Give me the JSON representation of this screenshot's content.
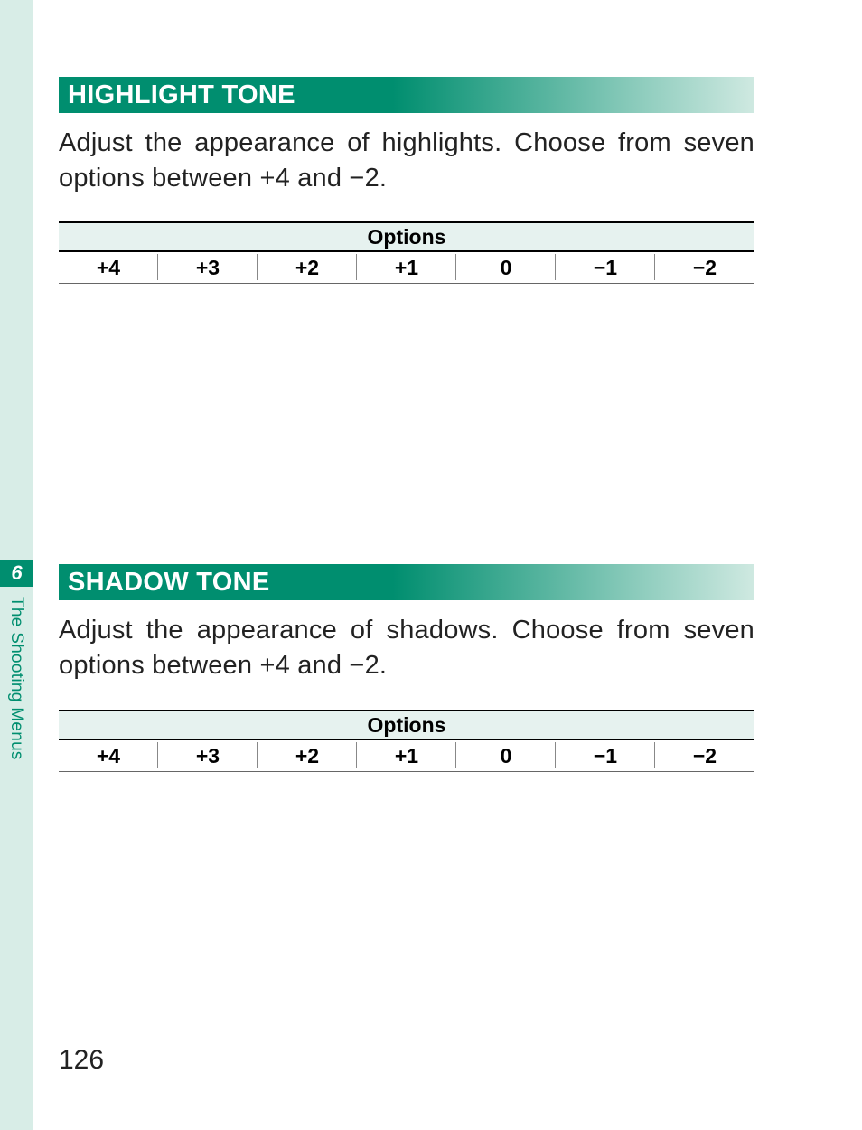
{
  "sidebar": {
    "chapter_number": "6",
    "chapter_title": "The Shooting Menus"
  },
  "sections": [
    {
      "heading": "HIGHLIGHT TONE",
      "body": "Adjust the appearance of highlights. Choose from seven options between +4 and −2.",
      "options_header": "Options",
      "options": [
        "+4",
        "+3",
        "+2",
        "+1",
        "0",
        "−1",
        "−2"
      ]
    },
    {
      "heading": "SHADOW TONE",
      "body": "Adjust the appearance of shadows. Choose from seven options between +4 and −2.",
      "options_header": "Options",
      "options": [
        "+4",
        "+3",
        "+2",
        "+1",
        "0",
        "−1",
        "−2"
      ]
    }
  ],
  "page_number": "126"
}
